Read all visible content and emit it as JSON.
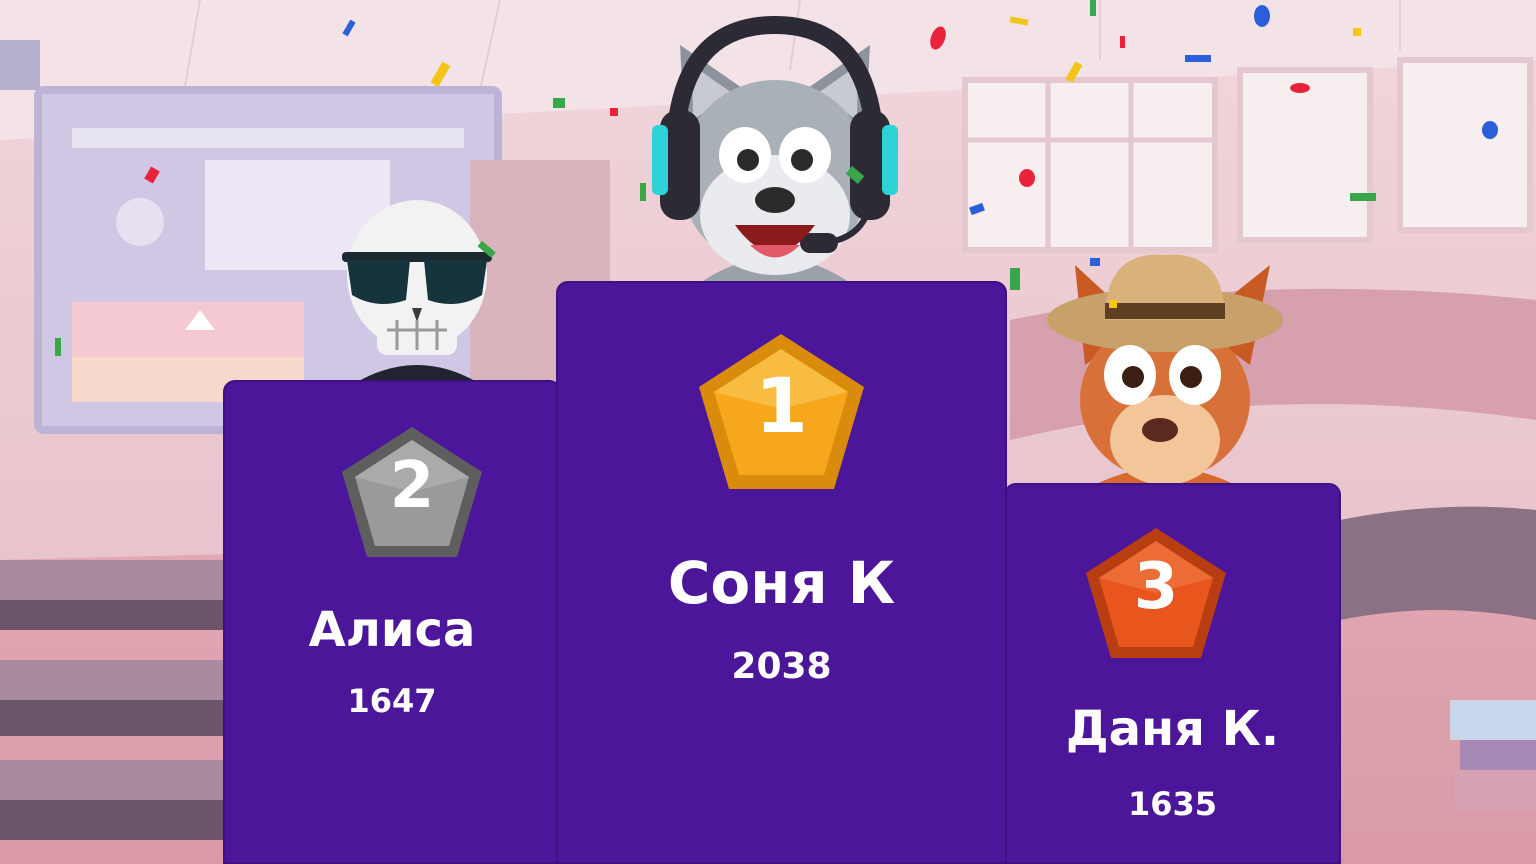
{
  "podium": {
    "first": {
      "rank": "1",
      "name": "Соня К",
      "score": "2038",
      "badge_color": "#f6a71c",
      "avatar": "wolf-with-headset-avatar"
    },
    "second": {
      "rank": "2",
      "name": "Алиса",
      "score": "1647",
      "badge_color": "#8a8a8a",
      "avatar": "skull-with-sunglasses-avatar"
    },
    "third": {
      "rank": "3",
      "name": "Даня К.",
      "score": "1635",
      "badge_color": "#e8561d",
      "avatar": "squirrel-with-cowboy-hat-avatar"
    }
  },
  "colors": {
    "podium": "#4b1699",
    "text": "#ffffff"
  }
}
